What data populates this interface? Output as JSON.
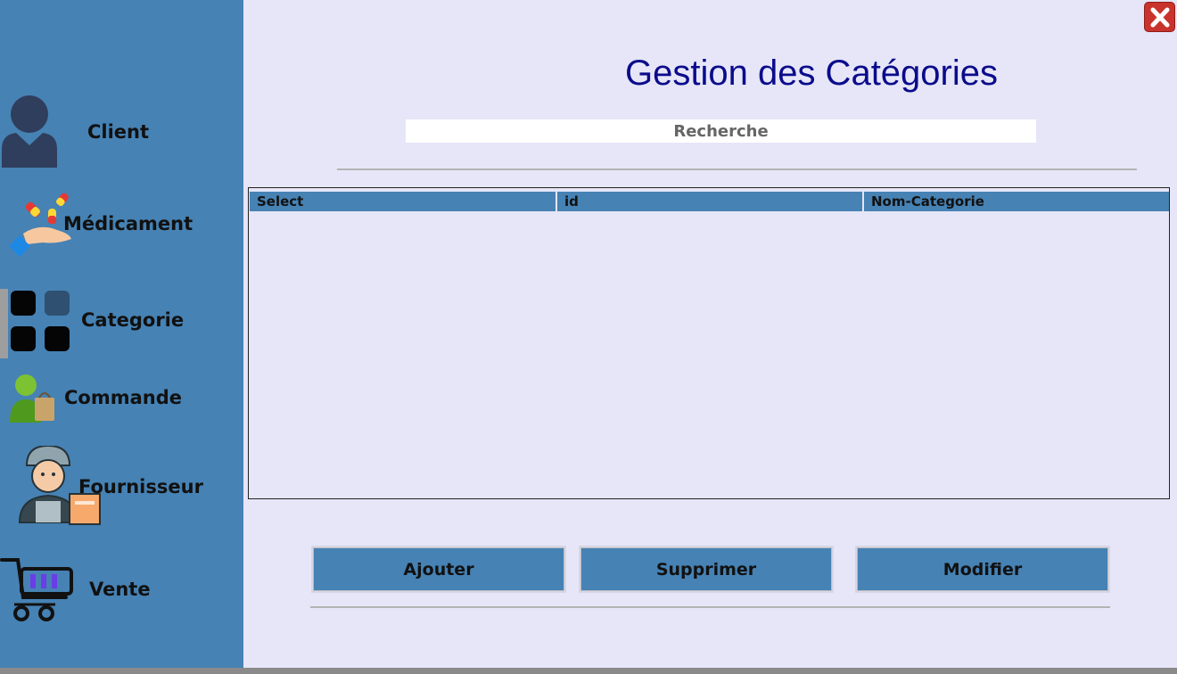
{
  "sidebar": {
    "items": [
      {
        "label": "Client",
        "icon": "person-icon"
      },
      {
        "label": "Médicament",
        "icon": "pills-hand-icon"
      },
      {
        "label": "Categorie",
        "icon": "grid-icon"
      },
      {
        "label": "Commande",
        "icon": "shopping-user-icon"
      },
      {
        "label": "Fournisseur",
        "icon": "delivery-man-icon"
      },
      {
        "label": "Vente",
        "icon": "cart-icon"
      }
    ],
    "active": "Categorie"
  },
  "header": {
    "title": "Gestion des Catégories"
  },
  "search": {
    "placeholder": "Recherche"
  },
  "table": {
    "columns": [
      "Select",
      "id",
      "Nom-Categorie"
    ],
    "rows": []
  },
  "actions": {
    "add_label": "Ajouter",
    "delete_label": "Supprimer",
    "edit_label": "Modifier"
  },
  "colors": {
    "sidebar": "#4682b4",
    "background": "#e6e6f8",
    "title": "#0b0b8c",
    "close": "#c8342d"
  }
}
